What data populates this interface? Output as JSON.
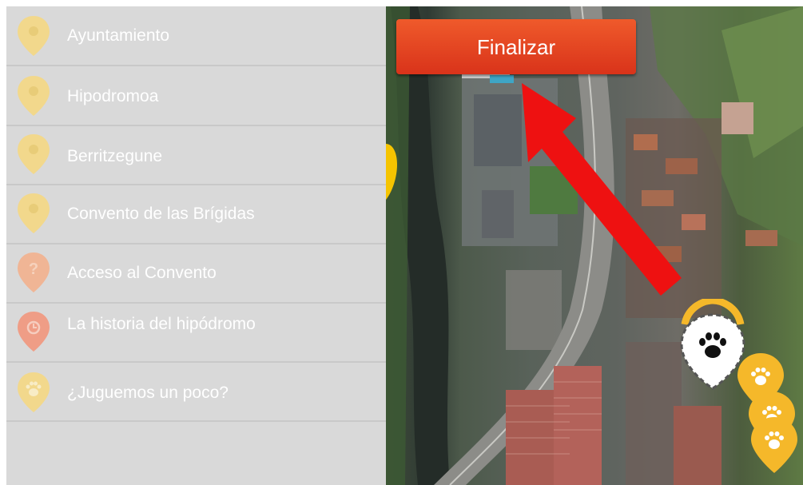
{
  "places": [
    {
      "label": "Ayuntamiento",
      "icon": "location-pin-icon",
      "color": "#f2d88c"
    },
    {
      "label": "Hipodromoa",
      "icon": "location-pin-icon",
      "color": "#f2d88c"
    },
    {
      "label": "Berritzegune",
      "icon": "location-pin-icon",
      "color": "#f2d88c"
    },
    {
      "label": "Convento de las Brígidas",
      "icon": "location-pin-icon",
      "color": "#f2d88c"
    },
    {
      "label": "Acceso al Convento",
      "icon": "question-pin-icon",
      "color": "#f0b595"
    },
    {
      "label": "La historia del hipódromo",
      "icon": "clock-pin-icon",
      "color": "#ef9d86"
    },
    {
      "label": "¿Juguemos un poco?",
      "icon": "paw-pin-icon",
      "color": "#f2d88c"
    }
  ],
  "map": {
    "finish_button": "Finalizar",
    "arrow_color": "#ee1111",
    "marker_color": "#f5b82a"
  }
}
